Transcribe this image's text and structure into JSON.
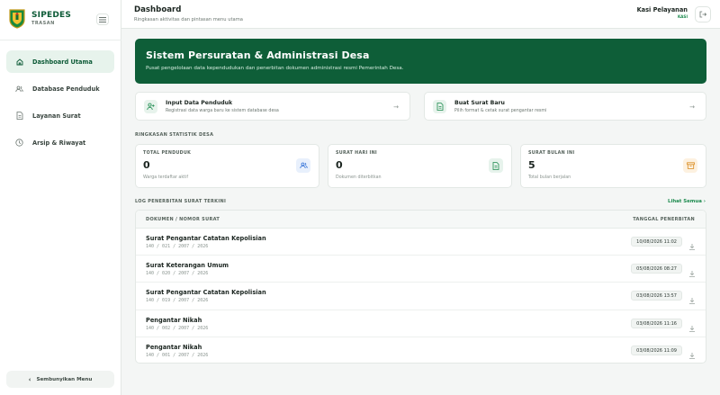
{
  "brand": {
    "name": "SIPEDES",
    "sub": "TRASAN"
  },
  "sidebar": {
    "items": [
      {
        "label": "Dashboard Utama",
        "icon": "home-icon",
        "active": true
      },
      {
        "label": "Database Penduduk",
        "icon": "users-icon",
        "active": false
      },
      {
        "label": "Layanan Surat",
        "icon": "document-icon",
        "active": false
      },
      {
        "label": "Arsip & Riwayat",
        "icon": "clock-icon",
        "active": false
      }
    ],
    "collapse_label": "Sembunyikan Menu"
  },
  "header": {
    "title": "Dashboard",
    "subtitle": "Ringkasan aktivitas dan pintasan menu utama",
    "user_name": "Kasi Pelayanan",
    "user_role": "KASI"
  },
  "hero": {
    "title": "Sistem Persuratan & Administrasi Desa",
    "subtitle": "Pusat pengelolaan data kependudukan dan penerbitan dokumen administrasi resmi Pemerintah Desa."
  },
  "actions": [
    {
      "title": "Input Data Penduduk",
      "subtitle": "Registrasi data warga baru ke sistem database desa",
      "icon": "user-plus-icon"
    },
    {
      "title": "Buat Surat Baru",
      "subtitle": "Pilih format & cetak surat pengantar resmi",
      "icon": "file-text-icon"
    }
  ],
  "stats_label": "RINGKASAN STATISTIK DESA",
  "stats": [
    {
      "label": "TOTAL PENDUDUK",
      "value": "0",
      "note": "Warga terdaftar aktif",
      "icon": "users-icon",
      "color": "#2f6fd6",
      "bg": "#e8f0fc"
    },
    {
      "label": "SURAT HARI INI",
      "value": "0",
      "note": "Dokumen diterbitkan",
      "icon": "file-text-icon",
      "color": "#1c8a4e",
      "bg": "#e7f3ec"
    },
    {
      "label": "SURAT BULAN INI",
      "value": "5",
      "note": "Total bulan berjalan",
      "icon": "archive-icon",
      "color": "#d98a1c",
      "bg": "#fdf1e0"
    }
  ],
  "log": {
    "label": "LOG PENERBITAN SURAT TERKINI",
    "see_all": "Lihat Semua",
    "col_doc": "DOKUMEN / NOMOR SURAT",
    "col_date": "TANGGAL PENERBITAN",
    "rows": [
      {
        "doc": "Surat Pengantar Catatan Kepolisian",
        "num": "140 / 021 / 2007 / 2026",
        "date": "10/08/2026 11:02"
      },
      {
        "doc": "Surat Keterangan Umum",
        "num": "140 / 020 / 2007 / 2026",
        "date": "05/08/2026 08:27"
      },
      {
        "doc": "Surat Pengantar Catatan Kepolisian",
        "num": "140 / 019 / 2007 / 2026",
        "date": "03/08/2026 13:57"
      },
      {
        "doc": "Pengantar Nikah",
        "num": "140 / 002 / 2007 / 2026",
        "date": "03/08/2026 11:16"
      },
      {
        "doc": "Pengantar Nikah",
        "num": "140 / 001 / 2007 / 2026",
        "date": "03/08/2026 11:09"
      }
    ]
  }
}
